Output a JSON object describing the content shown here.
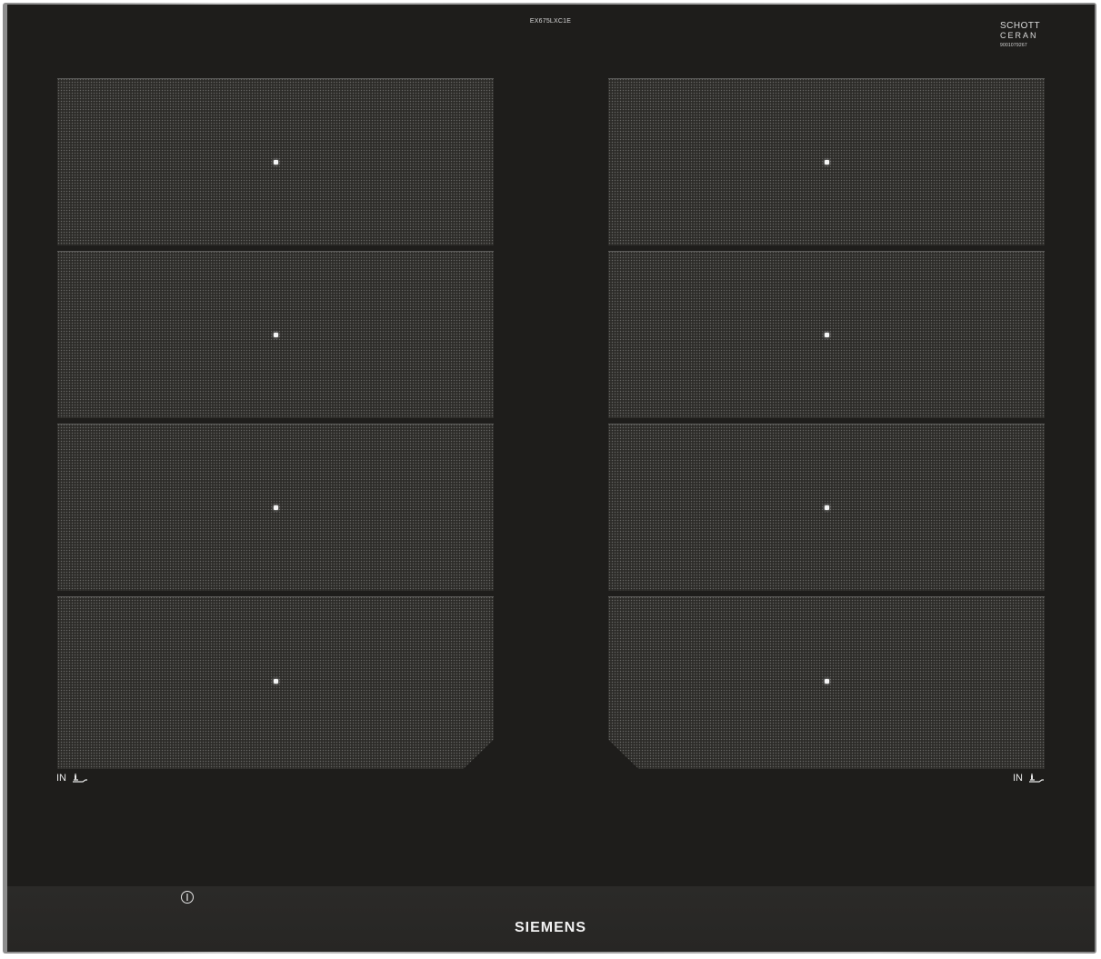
{
  "model_code": "EX675LXC1E",
  "glass_brand": {
    "line1": "SCHOTT",
    "line2": "CERAN",
    "serial": "9001079267"
  },
  "cooking_zones": {
    "left": [
      {
        "id": 1
      },
      {
        "id": 2
      },
      {
        "id": 3
      },
      {
        "id": 4
      }
    ],
    "right": [
      {
        "id": 5
      },
      {
        "id": 6
      },
      {
        "id": 7
      },
      {
        "id": 8
      }
    ]
  },
  "zone_indicator_left": {
    "label": "IN"
  },
  "zone_indicator_right": {
    "label": "IN"
  },
  "control_panel": {
    "info_icon": "info-icon",
    "brand_logo": "SIEMENS"
  },
  "colors": {
    "glass": "#1e1d1b",
    "zone_fill": "#2d2c29",
    "frame": "#b5b5b5",
    "indicator_dot": "#f4f4f4"
  }
}
